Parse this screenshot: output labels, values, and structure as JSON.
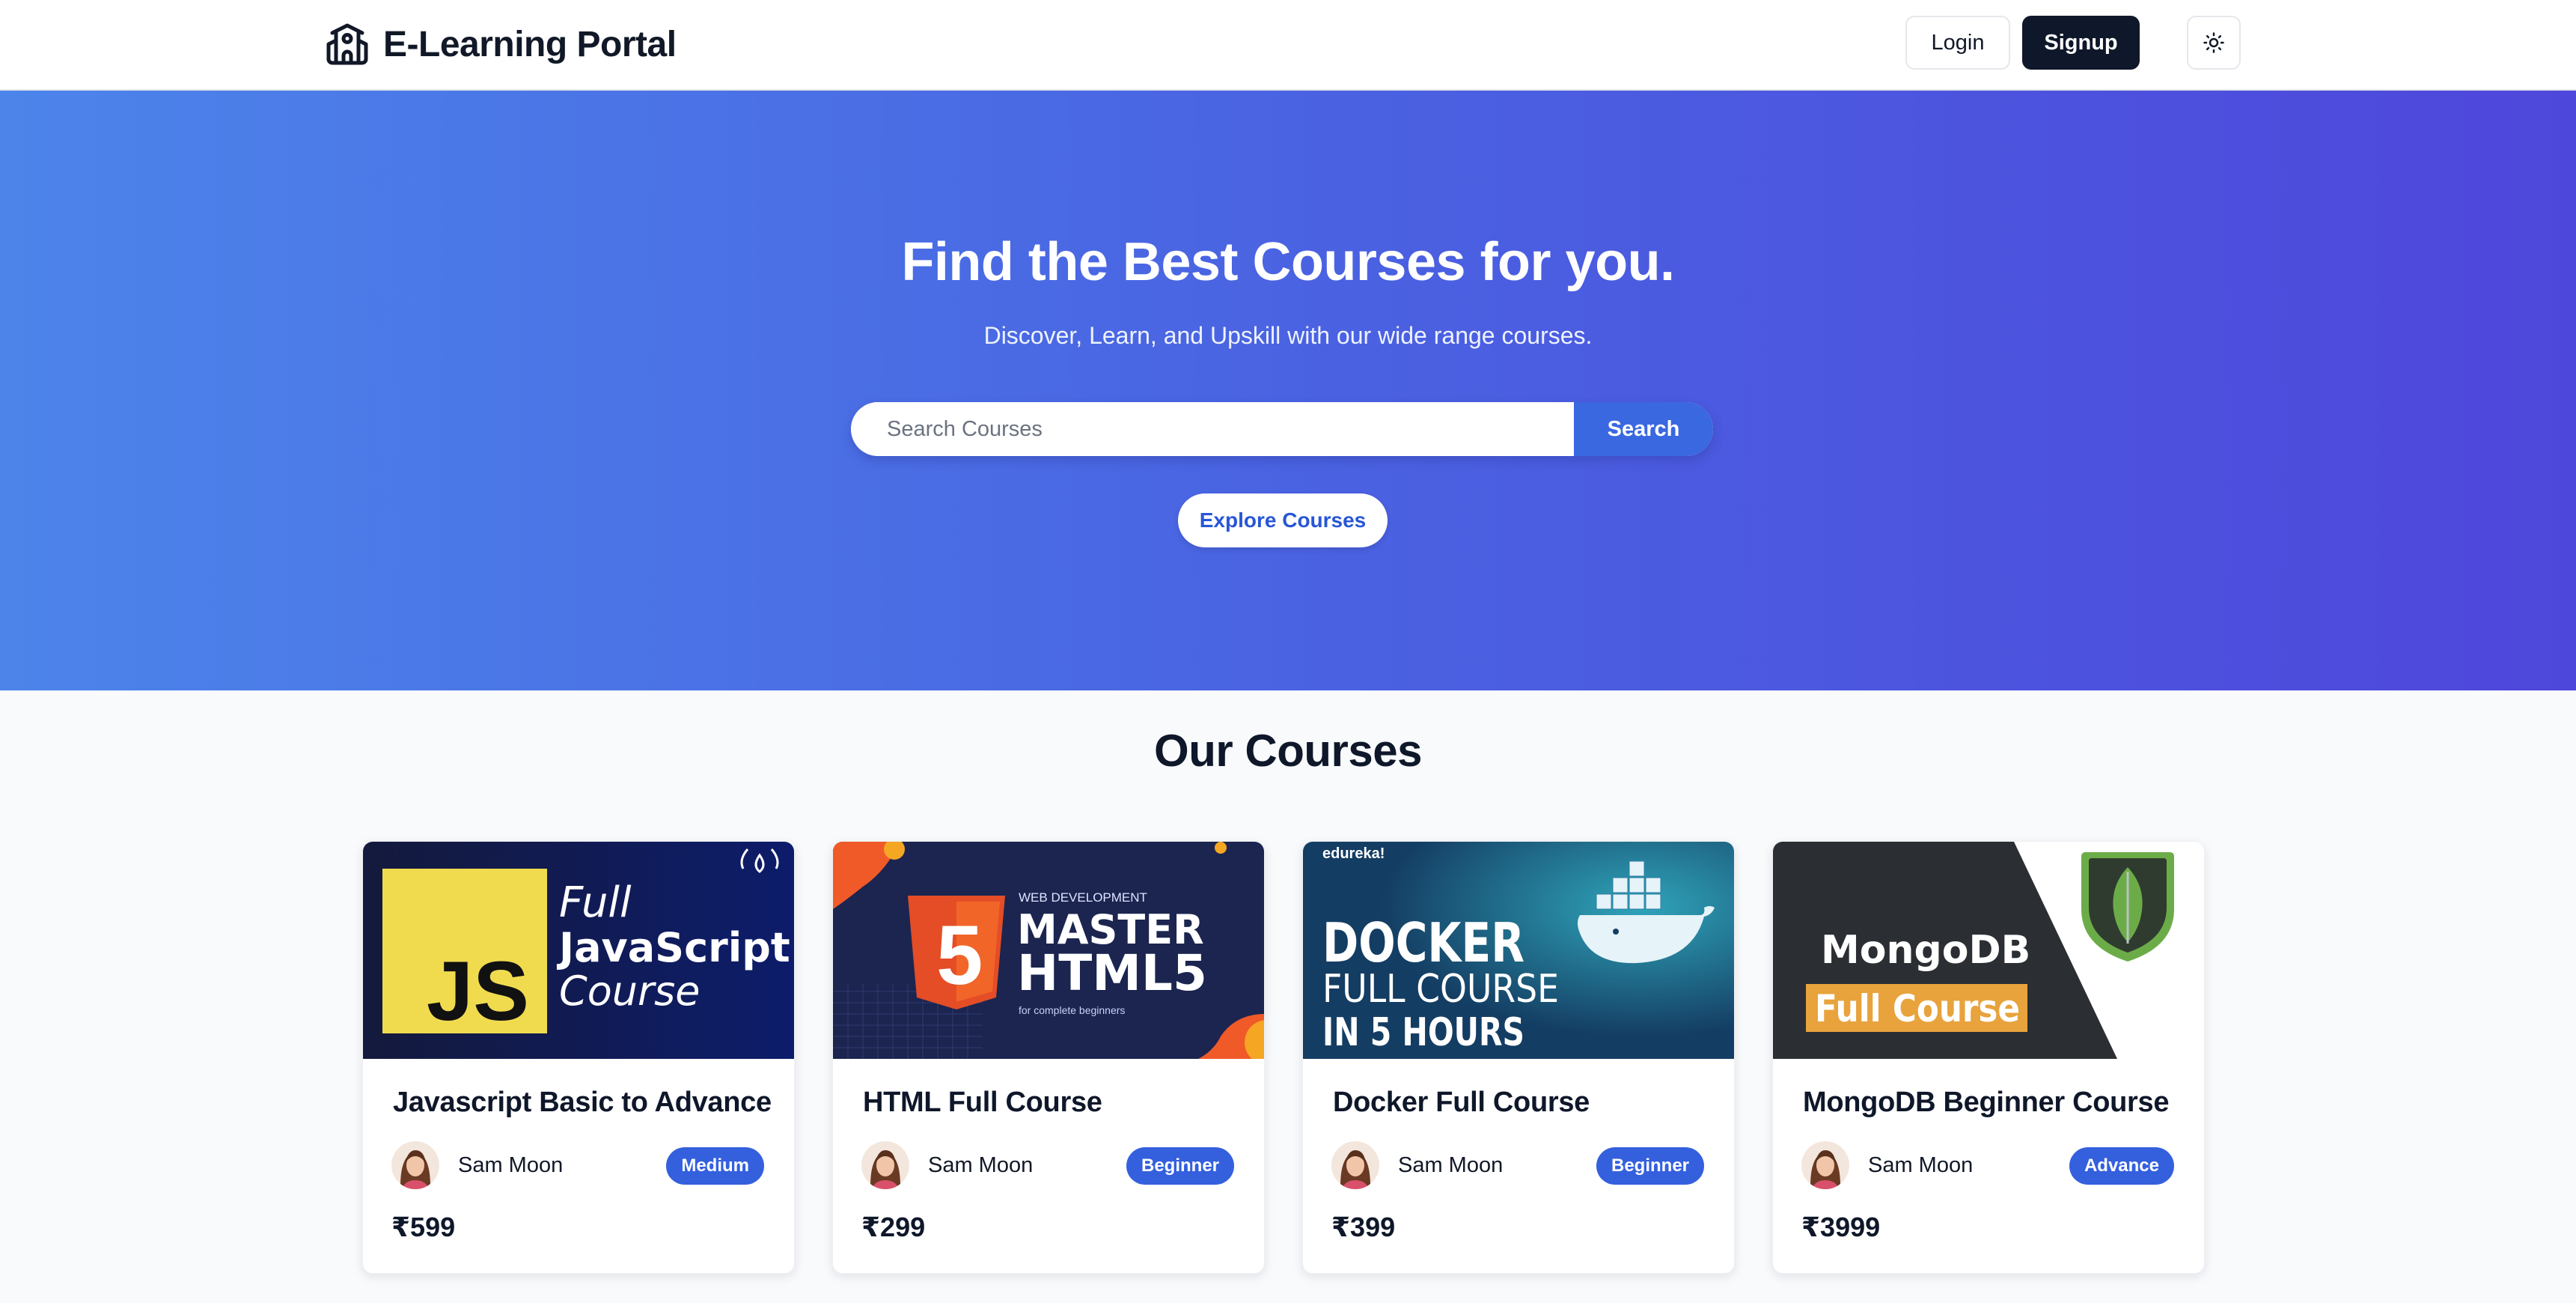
{
  "header": {
    "brand": "E-Learning Portal",
    "brand_icon": "school-building-icon",
    "login_label": "Login",
    "signup_label": "Signup",
    "theme_icon": "sun-icon"
  },
  "hero": {
    "title": "Find the Best Courses for you.",
    "subtitle": "Discover, Learn, and Upskill with our wide range courses.",
    "search_placeholder": "Search Courses",
    "search_value": "",
    "search_label": "Search",
    "explore_label": "Explore Courses"
  },
  "courses": {
    "title": "Our Courses",
    "items": [
      {
        "title": "Javascript Basic to Advance",
        "author": "Sam Moon",
        "level": "Medium",
        "price": "₹599",
        "thumb": {
          "line1": "Full",
          "line2": "JavaScript",
          "line3": "Course",
          "logo": "JS"
        }
      },
      {
        "title": "HTML Full Course",
        "author": "Sam Moon",
        "level": "Beginner",
        "price": "₹299",
        "thumb": {
          "kicker": "WEB DEVELOPMENT",
          "line1": "MASTER",
          "line2": "HTML5",
          "small": "for complete beginners",
          "logo": "5"
        }
      },
      {
        "title": "Docker Full Course",
        "author": "Sam Moon",
        "level": "Beginner",
        "price": "₹399",
        "thumb": {
          "brand": "edureka!",
          "line1": "DOCKER",
          "line2": "FULL COURSE",
          "line3": "IN 5 HOURS"
        }
      },
      {
        "title": "MongoDB Beginner Course",
        "author": "Sam Moon",
        "level": "Advance",
        "price": "₹3999",
        "thumb": {
          "line1": "MongoDB",
          "line2": "Full Course"
        }
      }
    ]
  },
  "colors": {
    "accent": "#3460dd",
    "hero_start": "#4c84ea",
    "hero_end": "#4e47db",
    "dark": "#0f172a"
  }
}
